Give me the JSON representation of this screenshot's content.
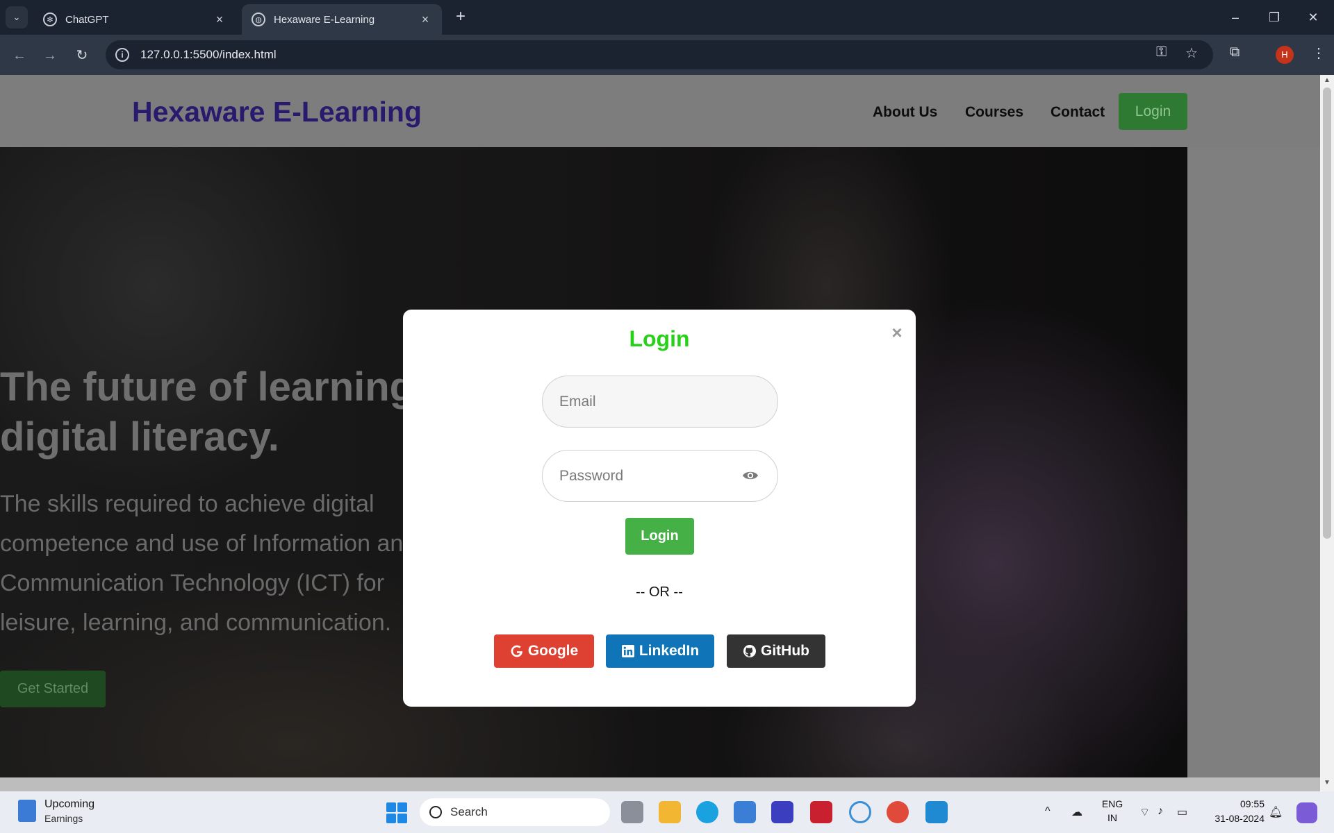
{
  "browser": {
    "tabs": [
      {
        "title": "ChatGPT",
        "active": false
      },
      {
        "title": "Hexaware E-Learning",
        "active": true
      }
    ],
    "url": "127.0.0.1:5500/index.html",
    "profile_initial": "H"
  },
  "site": {
    "brand": "Hexaware E-Learning",
    "nav": [
      "About Us",
      "Courses",
      "Contact"
    ],
    "nav_login": "Login",
    "hero_title": "The future of learning is digital literacy.",
    "hero_text": "The skills required to achieve digital competence and use of Information and Communication Technology (ICT) for leisure, learning, and communication.",
    "hero_cta": "Get Started"
  },
  "modal": {
    "title": "Login",
    "close": "×",
    "email_placeholder": "Email",
    "password_placeholder": "Password",
    "submit": "Login",
    "or_text": "-- OR --",
    "social": [
      {
        "label": "Google",
        "icon": "google-icon",
        "color": "#de4132"
      },
      {
        "label": "LinkedIn",
        "icon": "linkedin-icon",
        "color": "#0f75b8"
      },
      {
        "label": "GitHub",
        "icon": "github-icon",
        "color": "#333333"
      }
    ],
    "title_color": "#27d11a",
    "submit_color": "#45b045"
  },
  "taskbar": {
    "widget_title": "Upcoming",
    "widget_sub": "Earnings",
    "search": "Search",
    "lang": "ENG",
    "region": "IN",
    "time": "09:55",
    "date": "31-08-2024"
  }
}
